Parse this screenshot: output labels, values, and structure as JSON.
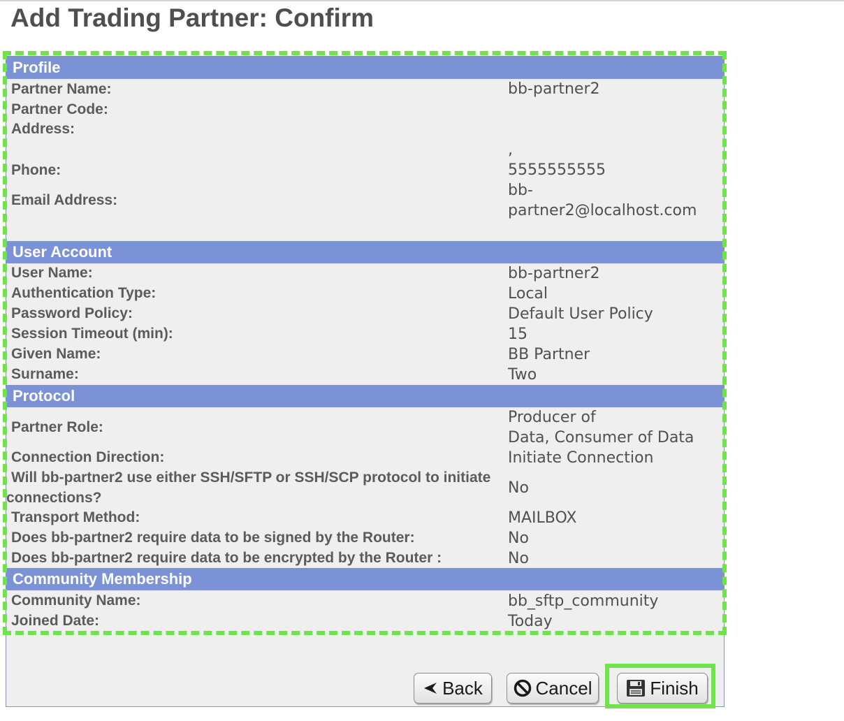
{
  "page": {
    "title": "Add Trading Partner: Confirm"
  },
  "sections": {
    "profile": {
      "heading": "Profile",
      "partner_name_label": "Partner Name:",
      "partner_name_value": "bb-partner2",
      "partner_code_label": "Partner Code:",
      "address_label": "Address:",
      "address_value": ",",
      "phone_label": "Phone:",
      "phone_value": "5555555555",
      "email_label": "Email Address:",
      "email_value_line1": "bb-",
      "email_value_line2": "partner2@localhost.com"
    },
    "user_account": {
      "heading": "User Account",
      "user_name_label": "User Name:",
      "user_name_value": "bb-partner2",
      "auth_type_label": "Authentication Type:",
      "auth_type_value": "Local",
      "password_policy_label": "Password Policy:",
      "password_policy_value": "Default User Policy",
      "session_timeout_label": "Session Timeout (min):",
      "session_timeout_value": "15",
      "given_name_label": "Given Name:",
      "given_name_value": "BB Partner",
      "surname_label": "Surname:",
      "surname_value": "Two"
    },
    "protocol": {
      "heading": "Protocol",
      "partner_role_label": "Partner Role:",
      "partner_role_value_line1": "Producer of",
      "partner_role_value_line2": "Data, Consumer of Data",
      "connection_direction_label": "Connection Direction:",
      "connection_direction_value": "Initiate Connection",
      "ssh_question_label": "Will bb-partner2 use either SSH/SFTP or SSH/SCP protocol to initiate connections?",
      "ssh_question_value": "No",
      "transport_method_label": "Transport Method:",
      "transport_method_value": "MAILBOX",
      "signed_question_label": "Does bb-partner2 require data to be signed by the Router:",
      "signed_question_value": "No",
      "encrypted_question_label": "Does bb-partner2 require data to be encrypted by the Router :",
      "encrypted_question_value": "No"
    },
    "community": {
      "heading": "Community Membership",
      "community_name_label": "Community Name:",
      "community_name_value": "bb_sftp_community",
      "joined_date_label": "Joined Date:",
      "joined_date_value": "Today"
    }
  },
  "buttons": {
    "back": "Back",
    "cancel": "Cancel",
    "finish": "Finish"
  },
  "icons": {
    "back": "back-arrow-icon",
    "cancel": "cancel-circle-icon",
    "finish": "save-disk-icon"
  },
  "colors": {
    "section_header": "#7b93d6",
    "panel_bg": "#efefef",
    "highlight": "#6ee34a"
  }
}
